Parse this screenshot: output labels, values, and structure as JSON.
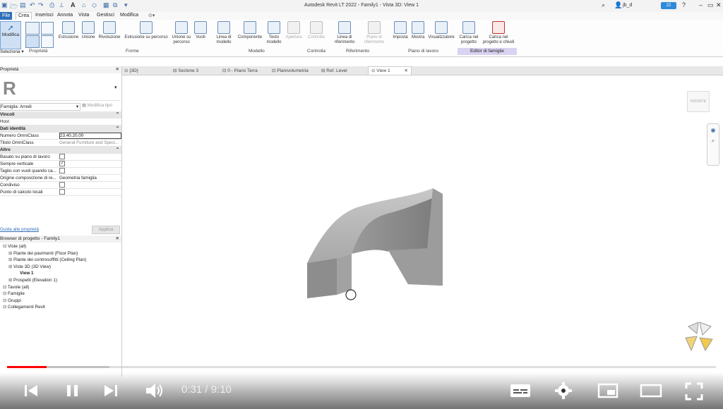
{
  "app": {
    "title": "Autodesk Revit LT 2022 - Family1 - Vista 3D: View 1",
    "user": "jb_d",
    "notif_count": "22"
  },
  "menu": [
    "File",
    "Crea",
    "Inserisci",
    "Annota",
    "Vista",
    "Gestisci",
    "Modifica"
  ],
  "ribbon": {
    "modifica": "Modifica",
    "seleziona": "Seleziona",
    "buttons": [
      {
        "label": "Estrusione",
        "icon": "extrusion-icon"
      },
      {
        "label": "Unione",
        "icon": "blend-icon"
      },
      {
        "label": "Rivoluzione",
        "icon": "revolve-icon"
      },
      {
        "label": "Estrusione su percorso",
        "icon": "sweep-icon"
      },
      {
        "label": "Unione su percorso",
        "icon": "swept-blend-icon"
      },
      {
        "label": "Vuoti",
        "icon": "void-icon"
      },
      {
        "label": "Linea di modello",
        "icon": "model-line-icon"
      },
      {
        "label": "Componente",
        "icon": "component-icon"
      },
      {
        "label": "Testo modello",
        "icon": "model-text-icon"
      },
      {
        "label": "Apertura",
        "icon": "opening-icon"
      },
      {
        "label": "Controllo",
        "icon": "control-icon"
      },
      {
        "label": "Linea di riferimento",
        "icon": "ref-line-icon"
      },
      {
        "label": "Piano di riferimento",
        "icon": "ref-plane-icon"
      },
      {
        "label": "Imposta",
        "icon": "set-icon"
      },
      {
        "label": "Mostra",
        "icon": "show-icon"
      },
      {
        "label": "Visualizzatore",
        "icon": "viewer-icon"
      },
      {
        "label": "Carica nel progetto",
        "icon": "load-project-icon"
      },
      {
        "label": "Carica nel progetto e chiudi",
        "icon": "load-close-icon"
      }
    ],
    "panels": [
      "Proprietà",
      "Forme",
      "Modello",
      "Controlla",
      "Riferimento",
      "Piano di lavoro",
      "Editor di famiglie"
    ]
  },
  "properties": {
    "title": "Proprietà",
    "family_selector": "Famiglia: Arredi",
    "edit_type": "Modifica tipo",
    "rows": [
      {
        "k": "Vincoli",
        "v": "",
        "section": true
      },
      {
        "k": "Host",
        "v": ""
      },
      {
        "k": "Dati identità",
        "v": "",
        "section": true
      },
      {
        "k": "Numero OmniClass",
        "v": "23.40.20.00"
      },
      {
        "k": "Titolo OmniClass",
        "v": "General Furniture and Speci..."
      },
      {
        "k": "Altro",
        "v": "",
        "section": true
      },
      {
        "k": "Basato su piano di lavoro",
        "v": "",
        "cb": true
      },
      {
        "k": "Sempre verticale",
        "v": "",
        "cb": true,
        "checked": true
      },
      {
        "k": "Taglio con vuoti quando ca...",
        "v": "",
        "cb": true
      },
      {
        "k": "Origine composizione di re...",
        "v": "Geometria famiglia"
      },
      {
        "k": "Condiviso",
        "v": "",
        "cb": true
      },
      {
        "k": "Punto di calcolo locali",
        "v": "",
        "cb": true
      }
    ],
    "help": "Guida alle proprietà",
    "apply": "Applica"
  },
  "browser": {
    "title": "Browser di progetto - Family1",
    "items": [
      {
        "label": "Viste (all)",
        "lvl": 0
      },
      {
        "label": "Piante dei pavimenti (Floor Plan)",
        "lvl": 1
      },
      {
        "label": "Piante dei controsoffitti (Ceiling Plan)",
        "lvl": 1
      },
      {
        "label": "Viste 3D (3D View)",
        "lvl": 1
      },
      {
        "label": "View 1",
        "lvl": 2,
        "bold": true
      },
      {
        "label": "Prospetti (Elevation 1)",
        "lvl": 1
      },
      {
        "label": "Tavole (all)",
        "lvl": 0
      },
      {
        "label": "Famiglie",
        "lvl": 0
      },
      {
        "label": "Gruppi",
        "lvl": 0
      },
      {
        "label": "Collegamenti Revit",
        "lvl": 0
      }
    ]
  },
  "tabs": [
    "{3D}",
    "Sezione 3",
    "0 - Piano Terra",
    "Planivolumetria",
    "Ref. Level",
    "View 1"
  ],
  "viewcube": "FRONTE",
  "player": {
    "time": "0:31 / 9:10",
    "progress": 0.056,
    "buffered": 0.144
  }
}
